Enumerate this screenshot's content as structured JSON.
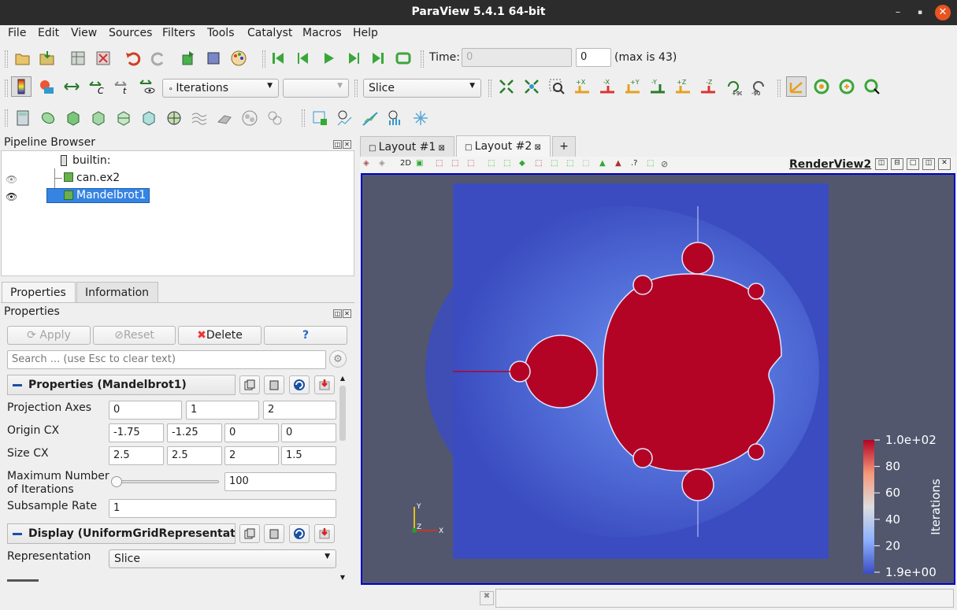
{
  "window": {
    "title": "ParaView 5.4.1 64-bit",
    "minimize": "–",
    "maximize": "▪",
    "close": "✕"
  },
  "menu": [
    "File",
    "Edit",
    "View",
    "Sources",
    "Filters",
    "Tools",
    "Catalyst",
    "Macros",
    "Help"
  ],
  "time_toolbar": {
    "time_label": "Time:",
    "time_value": "0",
    "index_value": "0",
    "max_label": "(max is 43)"
  },
  "color_toolbar": {
    "array": "Iterations",
    "component": "",
    "representation": "Slice"
  },
  "pipeline": {
    "title": "Pipeline Browser",
    "root": "builtin:",
    "items": [
      "can.ex2",
      "Mandelbrot1"
    ],
    "selected": "Mandelbrot1"
  },
  "panel_tabs": [
    "Properties",
    "Information"
  ],
  "properties": {
    "title": "Properties",
    "apply": "Apply",
    "reset": "Reset",
    "delete": "Delete",
    "help": "?",
    "search_placeholder": "Search ... (use Esc to clear text)",
    "section1": "Properties (Mandelbrot1)",
    "projection_axes_label": "Projection Axes",
    "projection_axes": [
      "0",
      "1",
      "2"
    ],
    "origin_label": "Origin CX",
    "origin": [
      "-1.75",
      "-1.25",
      "0",
      "0"
    ],
    "size_label": "Size CX",
    "size": [
      "2.5",
      "2.5",
      "2",
      "1.5"
    ],
    "max_iter_label_1": "Maximum Number",
    "max_iter_label_2": "of Iterations",
    "max_iter": "100",
    "max_iter_fraction": 0.0,
    "subsample_label": "Subsample Rate",
    "subsample": "1",
    "section2": "Display (UniformGridRepresentatic",
    "representation_label": "Representation",
    "representation": "Slice"
  },
  "layout_tabs": [
    "Layout #1",
    "Layout #2",
    "+"
  ],
  "render_view": {
    "name": "RenderView2",
    "btn_2d": "2D"
  },
  "colorbar": {
    "title": "Iterations",
    "ticks": [
      "1.0e+02",
      "80",
      "60",
      "40",
      "20",
      "1.9e+00"
    ]
  },
  "axes": {
    "x": "X",
    "y": "Y",
    "z": "Z"
  },
  "colors": {
    "background": "#52576e",
    "set_inside": "#b40426",
    "outside": "#3b4cc0",
    "selection": "#3584e4"
  }
}
